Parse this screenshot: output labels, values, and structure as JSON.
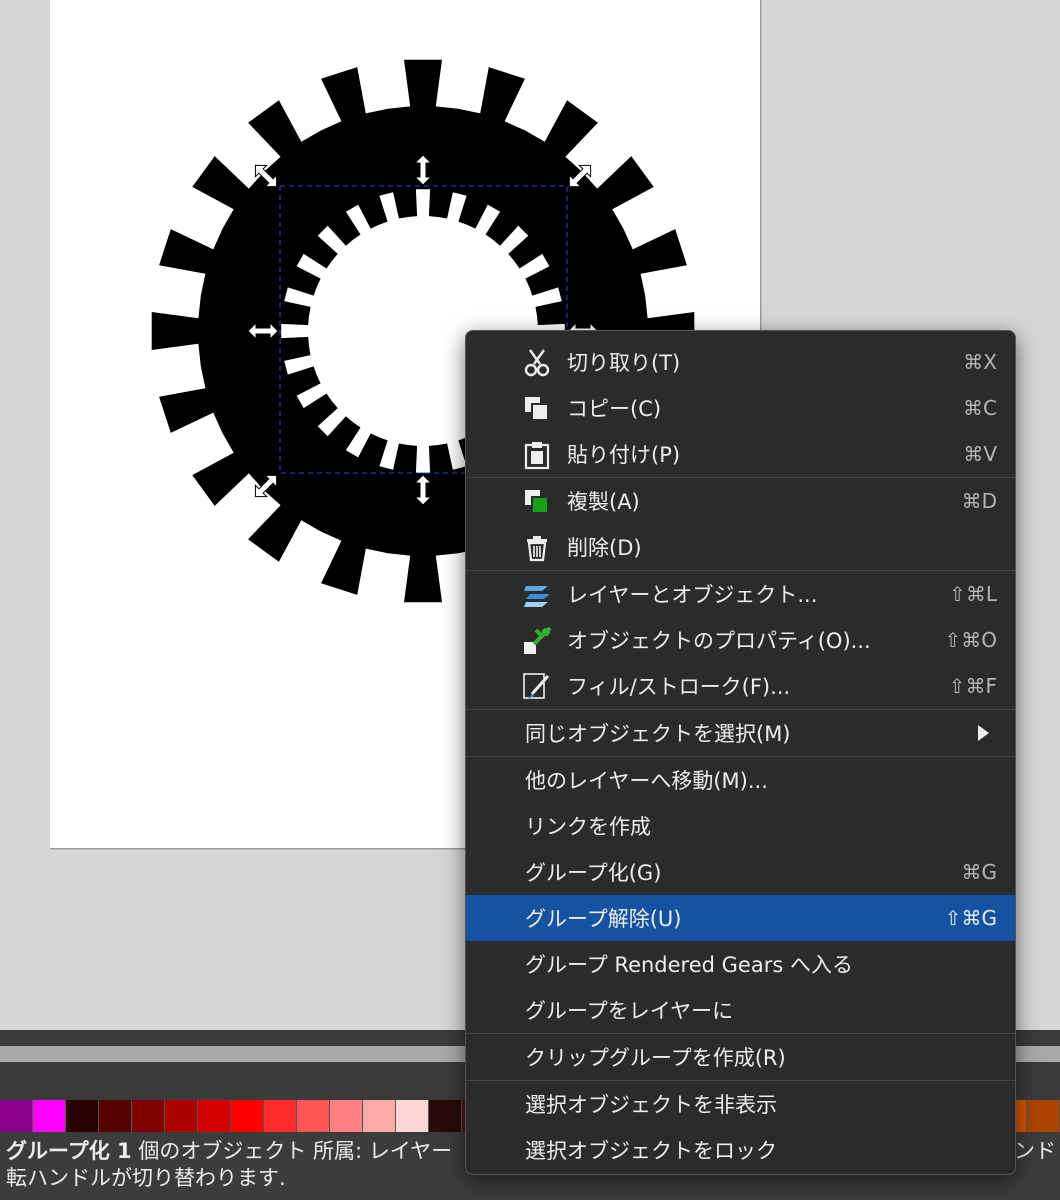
{
  "colors": {
    "canvas_bg": "#d6d6d6",
    "menu_bg": "#2b2b2b",
    "menu_highlight": "#1552a1",
    "selection_dash": "#3344cc"
  },
  "context_menu": {
    "groups": [
      [
        {
          "label": "切り取り(T)",
          "shortcut": "⌘X",
          "icon": "scissors-icon"
        },
        {
          "label": "コピー(C)",
          "shortcut": "⌘C",
          "icon": "copy-icon"
        },
        {
          "label": "貼り付け(P)",
          "shortcut": "⌘V",
          "icon": "paste-icon"
        }
      ],
      [
        {
          "label": "複製(A)",
          "shortcut": "⌘D",
          "icon": "duplicate-icon"
        },
        {
          "label": "削除(D)",
          "shortcut": "",
          "icon": "trash-icon"
        }
      ],
      [
        {
          "label": "レイヤーとオブジェクト...",
          "shortcut": "⇧⌘L",
          "icon": "layers-icon"
        },
        {
          "label": "オブジェクトのプロパティ(O)...",
          "shortcut": "⇧⌘O",
          "icon": "object-properties-icon"
        },
        {
          "label": "フィル/ストローク(F)...",
          "shortcut": "⇧⌘F",
          "icon": "fill-stroke-icon"
        }
      ],
      [
        {
          "label": "同じオブジェクトを選択(M)",
          "shortcut": "",
          "icon": "",
          "submenu": true
        }
      ],
      [
        {
          "label": "他のレイヤーへ移動(M)...",
          "shortcut": "",
          "icon": ""
        },
        {
          "label": "リンクを作成",
          "shortcut": "",
          "icon": ""
        },
        {
          "label": "グループ化(G)",
          "shortcut": "⌘G",
          "icon": ""
        },
        {
          "label": "グループ解除(U)",
          "shortcut": "⇧⌘G",
          "icon": "",
          "active": true
        },
        {
          "label": "グループ Rendered Gears へ入る",
          "shortcut": "",
          "icon": ""
        },
        {
          "label": "グループをレイヤーに",
          "shortcut": "",
          "icon": ""
        }
      ],
      [
        {
          "label": "クリップグループを作成(R)",
          "shortcut": "",
          "icon": ""
        }
      ],
      [
        {
          "label": "選択オブジェクトを非表示",
          "shortcut": "",
          "icon": ""
        },
        {
          "label": "選択オブジェクトをロック",
          "shortcut": "",
          "icon": ""
        }
      ]
    ]
  },
  "palette": {
    "left": [
      "#870087",
      "#ff00ff",
      "#2b0000",
      "#550000",
      "#800000",
      "#aa0000",
      "#d40000",
      "#ff0000",
      "#ff2a2a",
      "#ff5555",
      "#ff8080",
      "#ffaaaa",
      "#ffd5d5",
      "#280b0b",
      "#501616"
    ],
    "right": [
      "#d45500",
      "#aa4400"
    ]
  },
  "status": {
    "bold": "グループ化 1",
    "line1": " 個のオブジェクト 所属: レイヤー",
    "line1_right": "ンド",
    "line2": "転ハンドルが切り替わります."
  }
}
